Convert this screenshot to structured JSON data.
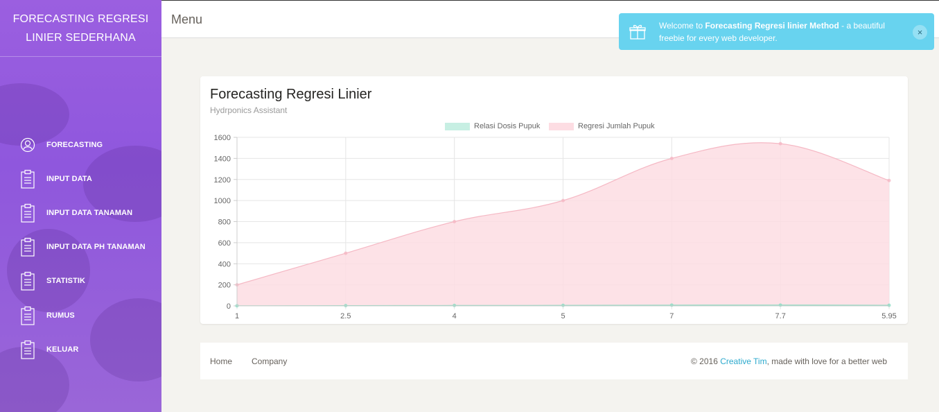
{
  "sidebar": {
    "brand_line1": "FORECASTING REGRESI",
    "brand_line2": "LINIER SEDERHANA",
    "items": [
      {
        "label": "FORECASTING",
        "icon": "user-circle-icon"
      },
      {
        "label": "INPUT DATA",
        "icon": "clipboard-icon"
      },
      {
        "label": "INPUT DATA TANAMAN",
        "icon": "clipboard-icon"
      },
      {
        "label": "INPUT DATA PH TANAMAN",
        "icon": "clipboard-icon"
      },
      {
        "label": "STATISTIK",
        "icon": "clipboard-icon"
      },
      {
        "label": "RUMUS",
        "icon": "clipboard-icon"
      },
      {
        "label": "KELUAR",
        "icon": "clipboard-icon"
      }
    ],
    "accent": "#9b5fe0"
  },
  "topbar": {
    "title": "Menu"
  },
  "notification": {
    "prefix": "Welcome to ",
    "bold": "Forecasting Regresi linier Method",
    "suffix": " - a beautiful freebie for every web developer.",
    "close": "×",
    "color": "#68d3ef"
  },
  "card": {
    "title": "Forecasting Regresi Linier",
    "subtitle": "Hydrponics Assistant"
  },
  "chart_data": {
    "type": "area",
    "categories": [
      "1",
      "2.5",
      "4",
      "5",
      "7",
      "7.7",
      "5.95"
    ],
    "series": [
      {
        "name": "Relasi Dosis Pupuk",
        "values": [
          1,
          2.5,
          4,
          5,
          7,
          7.7,
          5.95
        ],
        "color": "#c7efe3",
        "stroke": "#8fdcc4"
      },
      {
        "name": "Regresi Jumlah Pupuk",
        "values": [
          200,
          500,
          800,
          1000,
          1400,
          1540,
          1190
        ],
        "color": "#fddde3",
        "stroke": "#f5b8c4"
      }
    ],
    "yticks": [
      "0",
      "200",
      "400",
      "600",
      "800",
      "1000",
      "1200",
      "1400",
      "1600"
    ],
    "ylim": [
      0,
      1600
    ],
    "grid": true,
    "legend": "top"
  },
  "footer": {
    "links": [
      "Home",
      "Company"
    ],
    "copy_prefix": "© 2016 ",
    "copy_link": "Creative Tim",
    "copy_suffix": ", made with love for a better web"
  }
}
